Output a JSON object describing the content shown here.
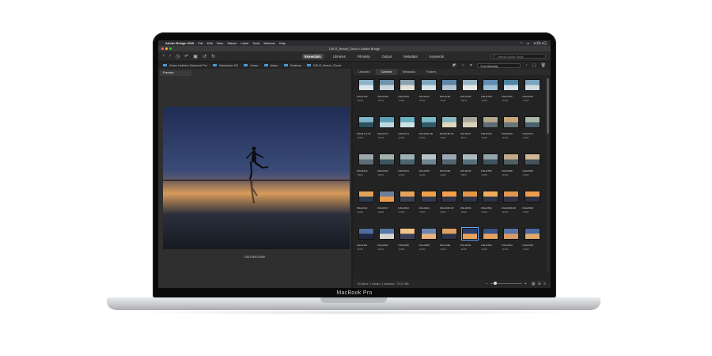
{
  "device": {
    "label": "MacBook Pro"
  },
  "menubar": {
    "apple": "",
    "app_name": "Adobe Bridge 2020",
    "items": [
      "File",
      "Edit",
      "View",
      "Stacks",
      "Label",
      "Tools",
      "Window",
      "Help"
    ],
    "clock": "11月12日"
  },
  "window": {
    "title": "DSLR_Beach_Shoot • Adobe Bridge"
  },
  "toolbar": {
    "workspaces": [
      "Essentials",
      "Libraries",
      "Filmstrip",
      "Output",
      "Metadata",
      "Keywords"
    ],
    "active_workspace": "Essentials",
    "search_placeholder": "Search Adobe Stock"
  },
  "path": [
    "Adam Hobbs's Macbook Pro",
    "Macintosh HD",
    "Users",
    "Adam",
    "Desktop",
    "DSLR_Beach_Shoot"
  ],
  "sort": {
    "label": "Sort Manually"
  },
  "preview": {
    "tab": "Preview",
    "caption": "DSLR392.RAW"
  },
  "content": {
    "tabs": [
      "Libraries",
      "Content",
      "Metadata",
      "Folders"
    ],
    "active_tab": "Content",
    "items": [
      {
        "name": "DSLR103",
        "ext": ".RAW",
        "c1": "#8fb4cc",
        "c2": "#dbe6ee"
      },
      {
        "name": "DSLR108",
        "ext": ".RAW",
        "c1": "#6f93ad",
        "c2": "#c9d6df"
      },
      {
        "name": "DSLR109",
        "ext": ".RAW",
        "c1": "#8aa1b1",
        "c2": "#e3e1d8"
      },
      {
        "name": "DSLR143",
        "ext": ".RAW",
        "c1": "#7ea6c0",
        "c2": "#d7e2e8"
      },
      {
        "name": "DSLR156",
        "ext": ".RAW",
        "c1": "#5d86a6",
        "c2": "#b3c6d2"
      },
      {
        "name": "DSLR169",
        "ext": ".HEIC",
        "c1": "#9ab4c4",
        "c2": "#e6e8e3"
      },
      {
        "name": "DSLR180",
        "ext": ".RAW",
        "c1": "#5f8fb5",
        "c2": "#9fc1d8"
      },
      {
        "name": "DSLR182",
        "ext": ".RAW",
        "c1": "#4f86a8",
        "c2": "#cfe0ea"
      },
      {
        "name": "DSLR166",
        "ext": ".RAW",
        "c1": "#7ba4be",
        "c2": "#d1dde2"
      },
      {
        "name": "DSLR171.tiff",
        "ext": ".RAW",
        "c1": "#7fb6c6",
        "c2": "#2c5160"
      },
      {
        "name": "DSLR173",
        "ext": ".RAW",
        "c1": "#5c9eb8",
        "c2": "#bcd8e0"
      },
      {
        "name": "DSLR174",
        "ext": ".RAW",
        "c1": "#6bb1c4",
        "c2": "#cde4e5"
      },
      {
        "name": "DSLR183.tiff",
        "ext": ".RAW",
        "c1": "#7cbac8",
        "c2": "#305866"
      },
      {
        "name": "DSLR186.tiff",
        "ext": ".RAW",
        "c1": "#86b9c1",
        "c2": "#e1d7bd"
      },
      {
        "name": "DSLR227",
        "ext": ".MOV",
        "c1": "#a9a69a",
        "c2": "#d8d1bd"
      },
      {
        "name": "DSLR228",
        "ext": ".RAW",
        "c1": "#b4a88e",
        "c2": "#5e6d73"
      },
      {
        "name": "DSLR229",
        "ext": ".RAW",
        "c1": "#c9a97c",
        "c2": "#6a7478"
      },
      {
        "name": "DSLR231",
        "ext": ".RAW",
        "c1": "#a9b7a6",
        "c2": "#49626c"
      },
      {
        "name": "DSLR232",
        "ext": ".HEIC",
        "c1": "#9aa7ab",
        "c2": "#5f6e75"
      },
      {
        "name": "DSLR233",
        "ext": ".RAW",
        "c1": "#a5b0ad",
        "c2": "#3d5560"
      },
      {
        "name": "DSLR234",
        "ext": ".RAW",
        "c1": "#9fb0b2",
        "c2": "#4c6570"
      },
      {
        "name": "DSLR236",
        "ext": ".RAW",
        "c1": "#b7c3c6",
        "c2": "#6f8590"
      },
      {
        "name": "DSLR238",
        "ext": ".RAW",
        "c1": "#9aa9b3",
        "c2": "#54636d"
      },
      {
        "name": "DSLR239",
        "ext": ".HEIC",
        "c1": "#aab9c0",
        "c2": "#58707c"
      },
      {
        "name": "DSLR306",
        "ext": ".RAW",
        "c1": "#93a3ab",
        "c2": "#3f545e"
      },
      {
        "name": "DSLR308",
        "ext": ".RAW",
        "c1": "#c2a98a",
        "c2": "#505e66"
      },
      {
        "name": "DSLR309",
        "ext": ".RAW",
        "c1": "#d0b693",
        "c2": "#46525a"
      },
      {
        "name": "DSLR312",
        "ext": ".RAW",
        "c1": "#e2a15a",
        "c2": "#2c3a4b"
      },
      {
        "name": "DSLR317",
        "ext": ".RAW",
        "c1": "#6a7f9c",
        "c2": "#e89a4b"
      },
      {
        "name": "DSLR340",
        "ext": ".RAW",
        "c1": "#e5a25c",
        "c2": "#3a3f52"
      },
      {
        "name": "DSLR341",
        "ext": ".HEIC",
        "c1": "#ee9f4a",
        "c2": "#323a4c"
      },
      {
        "name": "DSLR345.tiff",
        "ext": ".RAW",
        "c1": "#f2a04d",
        "c2": "#2f3547"
      },
      {
        "name": "DSLR356",
        "ext": ".RAW",
        "c1": "#e39449",
        "c2": "#2d3446"
      },
      {
        "name": "DSLR366",
        "ext": ".RAW",
        "c1": "#f0ab5b",
        "c2": "#2b3344"
      },
      {
        "name": "DSLR368.tiff",
        "ext": ".RAW",
        "c1": "#e09850",
        "c2": "#2f3447"
      },
      {
        "name": "DSLR369",
        "ext": ".RAW",
        "c1": "#ec9d4c",
        "c2": "#2a3042"
      },
      {
        "name": "DSLR381",
        "ext": ".RAW",
        "c1": "#4f6c9c",
        "c2": "#1f2940"
      },
      {
        "name": "DSLR382",
        "ext": ".RAW",
        "c1": "#5b79a8",
        "c2": "#d7d3cf"
      },
      {
        "name": "DSLR385",
        "ext": ".RAW",
        "c1": "#f3c28a",
        "c2": "#3b4258"
      },
      {
        "name": "DSLR386",
        "ext": ".RAW",
        "c1": "#6c86b2",
        "c2": "#e7b37c"
      },
      {
        "name": "DSLR389",
        "ext": ".RAW",
        "c1": "#dfa164",
        "c2": "#2b3149"
      },
      {
        "name": "DSLR392",
        "ext": ".RAW",
        "c1": "#2c3f6c",
        "c2": "#e8a35a",
        "selected": true
      },
      {
        "name": "DSLR393",
        "ext": ".RAW",
        "c1": "#3b5286",
        "c2": "#e3a062"
      },
      {
        "name": "DSLR394",
        "ext": ".RAW",
        "c1": "#5674a6",
        "c2": "#d89b64"
      },
      {
        "name": "DSLR395",
        "ext": ".RAW",
        "c1": "#4a6aa0",
        "c2": "#e1a86c"
      }
    ],
    "status": "45 items, 2 hidden, 1 selected - 79.67 MB"
  }
}
